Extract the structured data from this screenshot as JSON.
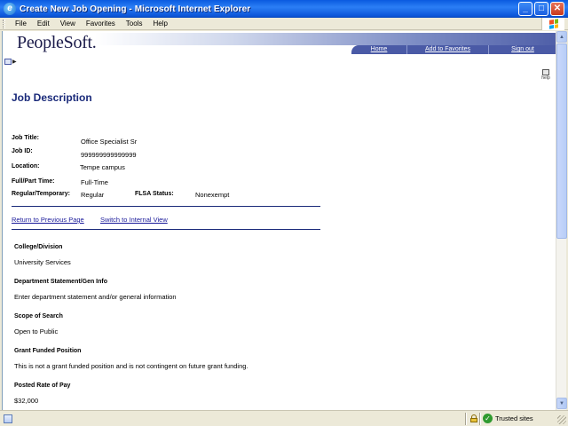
{
  "window": {
    "title": "Create New Job Opening - Microsoft Internet Explorer",
    "minimize_glyph": "_",
    "maximize_glyph": "□",
    "close_glyph": "✕"
  },
  "menubar": {
    "items": [
      "File",
      "Edit",
      "View",
      "Favorites",
      "Tools",
      "Help"
    ]
  },
  "header": {
    "logo": "PeopleSoft.",
    "nav": [
      "Home",
      "Add to Favorites",
      "Sign out"
    ],
    "help_label": "help"
  },
  "page": {
    "title": "Job Description",
    "fields": {
      "job_title_label": "Job Title:",
      "job_title_value": "Office Specialist Sr",
      "job_id_label": "Job ID:",
      "job_id_value": "999999999999999",
      "location_label": "Location:",
      "location_value": "Tempe campus",
      "fullpart_label": "Full/Part Time:",
      "fullpart_value": "Full-Time",
      "regtemp_label": "Regular/Temporary:",
      "regtemp_value": "Regular",
      "flsa_label": "FLSA Status:",
      "flsa_value": "Nonexempt"
    },
    "links": {
      "return": "Return to Previous Page",
      "switch": "Switch to Internal View"
    },
    "sections": [
      {
        "label": "College/Division",
        "value": "University Services"
      },
      {
        "label": "Department Statement/Gen Info",
        "value": "Enter department statement and/or general information"
      },
      {
        "label": "Scope of Search",
        "value": "Open to Public"
      },
      {
        "label": "Grant Funded Position",
        "value": "This is not a grant funded position and is not contingent on future grant funding."
      },
      {
        "label": "Posted Rate of Pay",
        "value": "$32,000"
      }
    ]
  },
  "statusbar": {
    "zone": "Trusted sites"
  },
  "colors": {
    "title_blue": "#1a2a7a",
    "link_blue": "#1a1a9a",
    "nav_band": "#4a5aa6"
  }
}
